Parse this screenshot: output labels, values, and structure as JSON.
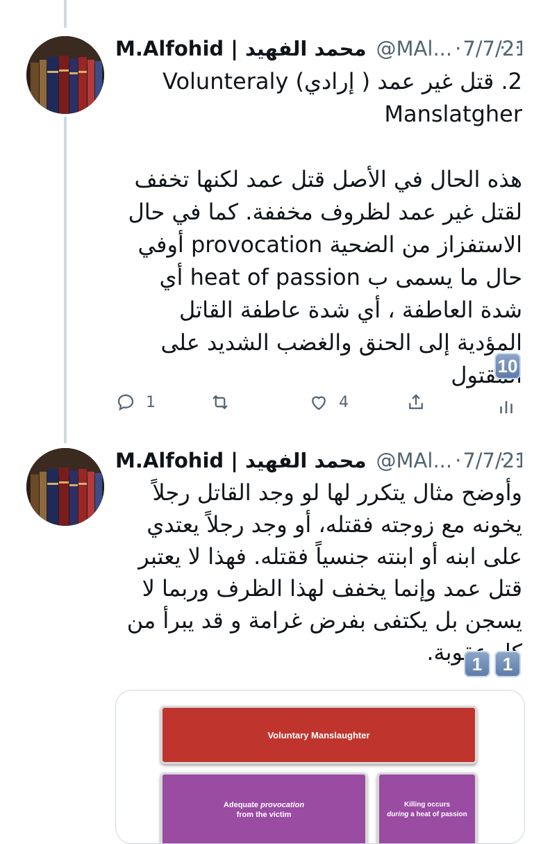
{
  "colors": {
    "accent_text": "#0f1419",
    "muted": "#536471",
    "diagram_red": "#c0342e",
    "diagram_purple": "#9a4ba2"
  },
  "tweets": [
    {
      "author_name": "M.Alfohid | محمد الفهيد",
      "handle": "@MAl...",
      "date": "7/7/21",
      "text": "2. قتل غير عمد ( إرادي) Volunteraly Manslatgher\n\nهذه الحال في الأصل قتل عمد لكنها تخفف لقتل غير عمد لظروف مخففة. كما في حال الاستفزاز من الضحية provocation أوفي حال ما يسمى ب heat of passion أي شدة العاطفة ، أي شدة عاطفة القاتل المؤدية إلى الحنق والغضب الشديد على المقتول",
      "number_emoji": [
        "10"
      ],
      "replies": "1",
      "likes": "4"
    },
    {
      "author_name": "M.Alfohid | محمد الفهيد",
      "handle": "@MAl...",
      "date": "7/7/21",
      "text": "وأوضح مثال يتكرر لها لو وجد القاتل رجلاً يخونه مع زوجته فقتله، أو وجد رجلاً يعتدي على ابنه أو ابنته جنسياً فقتله. فهذا لا يعتبر قتل عمد وإنما يخفف لهذا الظرف وربما لا يسجن بل يكتفى بفرض غرامة و قد يبرأ من كل عقوبة.",
      "number_emoji": [
        "1",
        "1"
      ]
    }
  ],
  "diagram": {
    "title": "Voluntary Manslaughter",
    "box1_pre": "Adequate ",
    "box1_em": "provocation",
    "box1_post": "from the victim",
    "box2_pre": "Killing occurs",
    "box2_em": "during",
    "box2_post": "a heat of passion"
  }
}
